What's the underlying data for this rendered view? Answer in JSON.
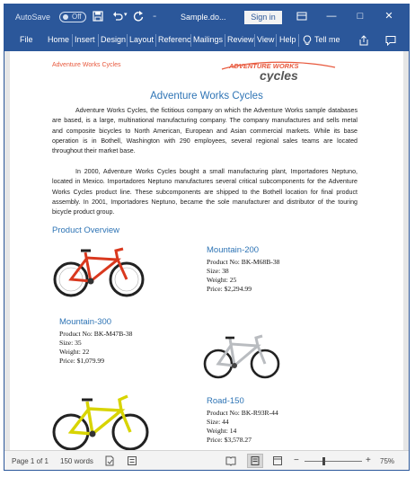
{
  "titlebar": {
    "autosave_label": "AutoSave",
    "autosave_state": "Off",
    "doc_name": "Sample.do...",
    "signin_label": "Sign in",
    "minimize": "—",
    "maximize": "□",
    "close": "✕"
  },
  "ribbon": {
    "tabs": [
      "File",
      "Home",
      "Insert",
      "Design",
      "Layout",
      "Referenc",
      "Mailings",
      "Review",
      "View",
      "Help"
    ],
    "tell_me": "Tell me"
  },
  "document": {
    "header_left": "Adventure Works Cycles",
    "logo_text_top": "ADVENTURE WORKS",
    "logo_text_bottom": "cycles",
    "title": "Adventure Works Cycles",
    "paragraph1": "Adventure Works Cycles, the fictitious company on which the Adventure Works sample databases are based, is a large, multinational manufacturing company. The company manufactures and sells metal and composite bicycles to North American, European and Asian commercial markets. While its base operation is in Bothell, Washington with 290 employees, several regional sales teams are located throughout their market base.",
    "paragraph2": "In 2000, Adventure Works Cycles bought a small manufacturing plant, Importadores Neptuno, located in Mexico. Importadores Neptuno manufactures several critical subcomponents for the Adventure Works Cycles product line. These subcomponents are shipped to the Bothell location for final product assembly. In 2001, Importadores Neptuno, became the sole manufacturer and distributor of the touring bicycle product group.",
    "section_heading": "Product Overview",
    "products": [
      {
        "name": "Mountain-200",
        "product_no": "Product No: BK-M68B-38",
        "size": "Size: 38",
        "weight": "Weight: 25",
        "price": "Price: $2,294.99"
      },
      {
        "name": "Mountain-300",
        "product_no": "Product No: BK-M47B-38",
        "size": "Size: 35",
        "weight": "Weight: 22",
        "price": "Price: $1,079.99"
      },
      {
        "name": "Road-150",
        "product_no": "Product No: BK-R93R-44",
        "size": "Size: 44",
        "weight": "Weight: 14",
        "price": "Price: $3,578.27"
      }
    ]
  },
  "statusbar": {
    "page": "Page 1 of 1",
    "words": "150 words",
    "zoom_minus": "−",
    "zoom_plus": "+",
    "zoom_level": "75%"
  },
  "colors": {
    "brand": "#2b579a",
    "heading": "#2e74b5",
    "header_text": "#e8583c"
  },
  "icons": [
    "save-icon",
    "undo-icon",
    "redo-icon",
    "customize-icon",
    "lightbulb-icon",
    "share-icon",
    "comments-icon",
    "proofing-icon",
    "track-icon",
    "read-mode-icon",
    "print-layout-icon",
    "web-layout-icon"
  ]
}
